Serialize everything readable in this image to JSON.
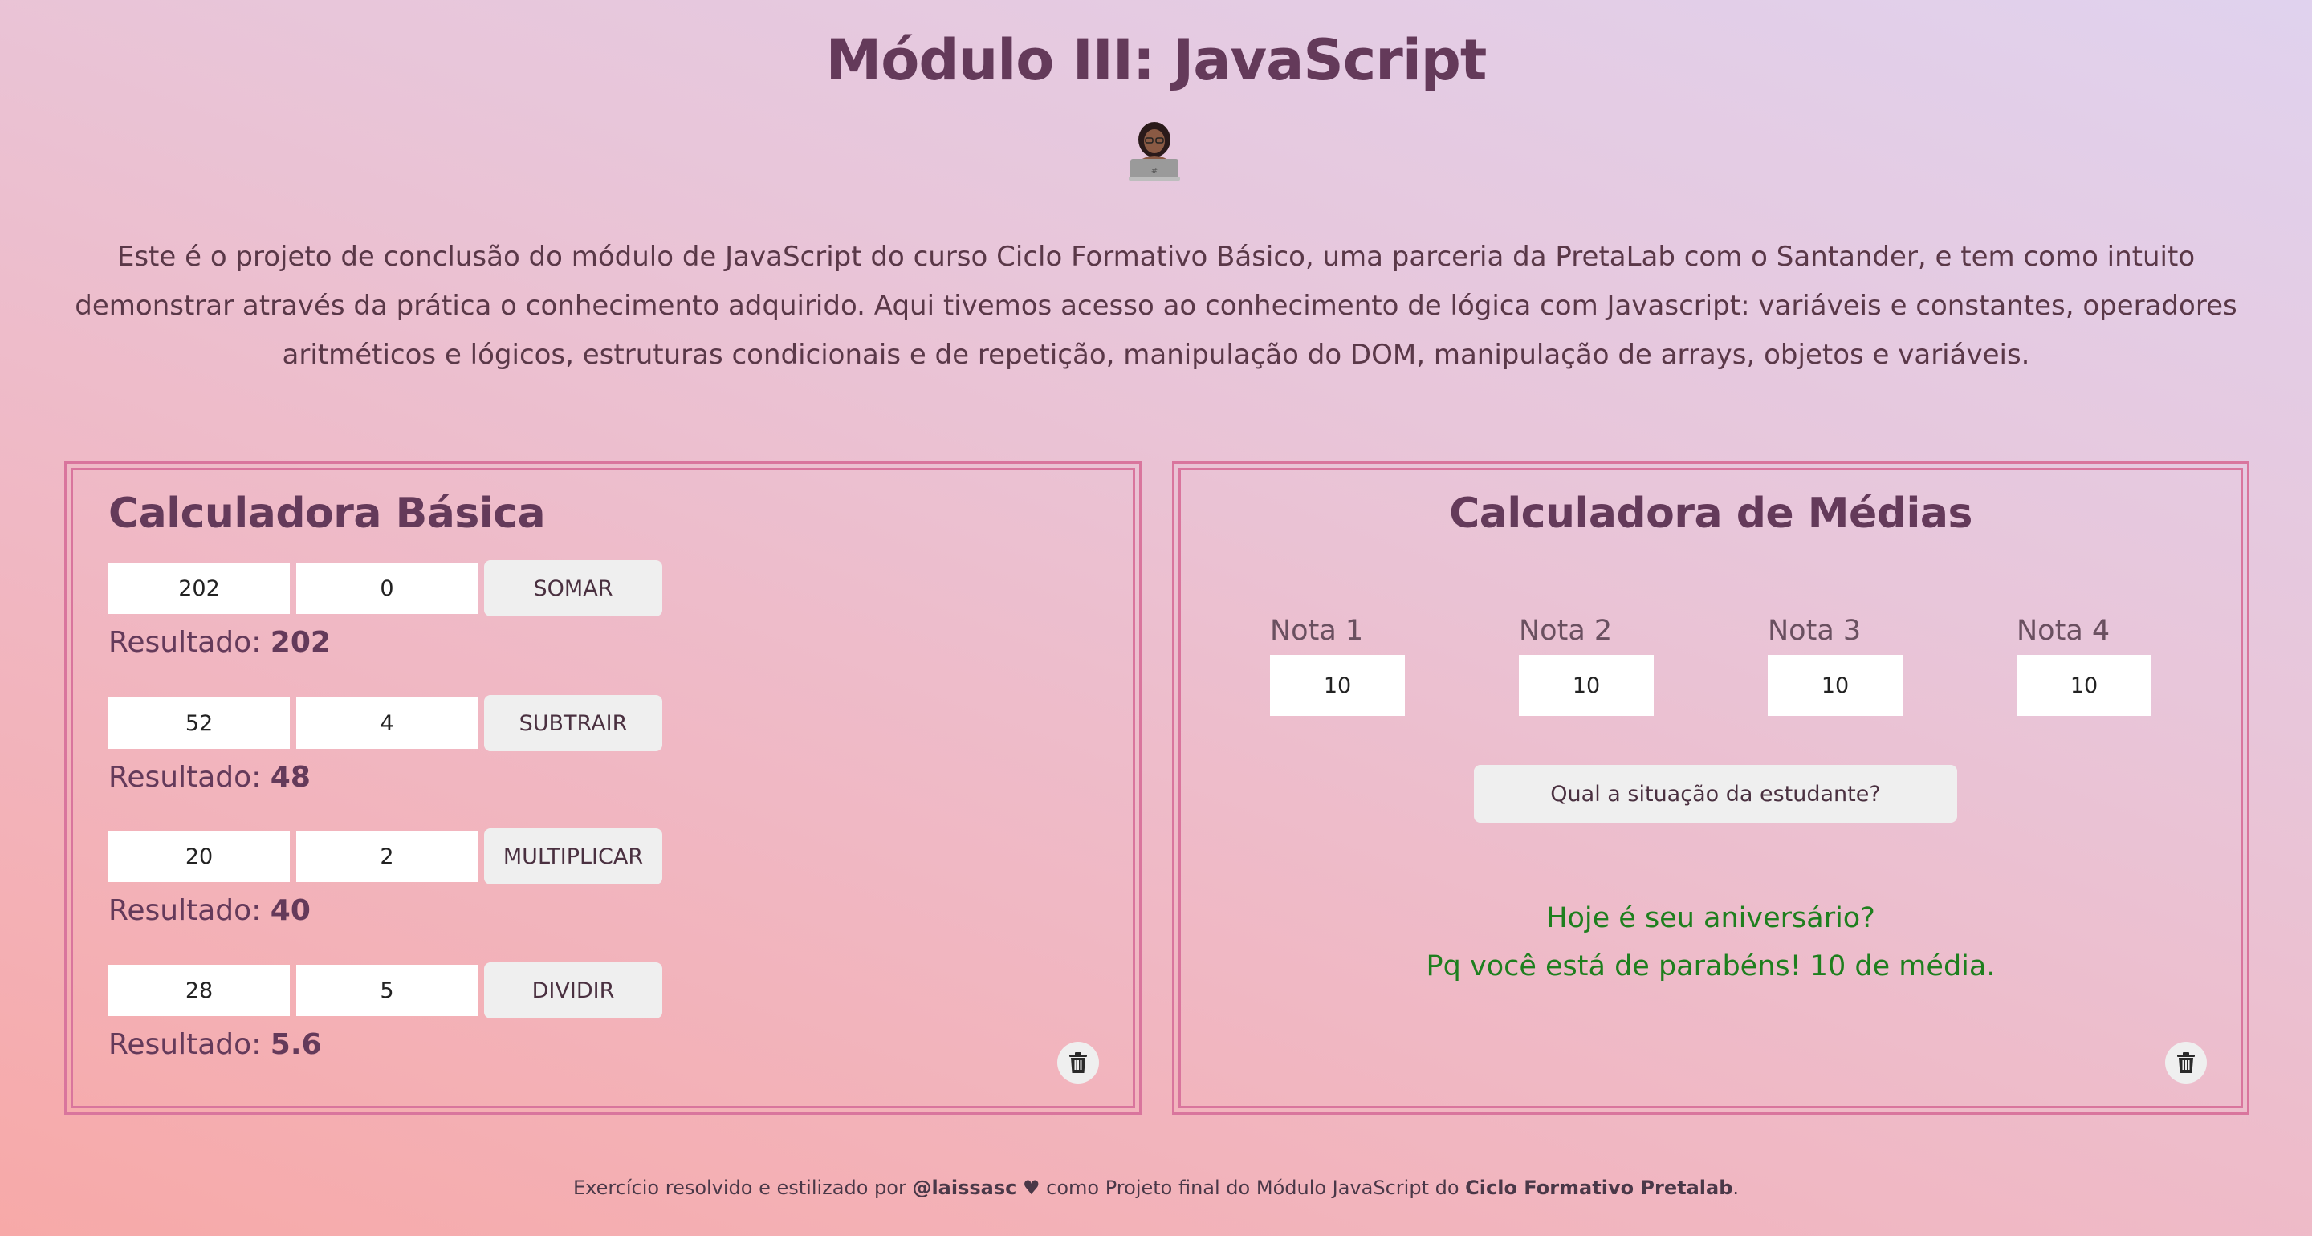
{
  "header": {
    "title": "Módulo III: JavaScript",
    "emoji_icon": "woman-technologist-icon",
    "intro": "Este é o projeto de conclusão do módulo de JavaScript do curso Ciclo Formativo Básico, uma parceria da PretaLab com o Santander, e tem como intuito demonstrar através da prática o conhecimento adquirido. Aqui tivemos acesso ao conhecimento de lógica com Javascript: variáveis e constantes, operadores aritméticos e lógicos, estruturas condicionais e de repetição, manipulação do DOM, manipulação de arrays, objetos e variáveis."
  },
  "basic_calc": {
    "title": "Calculadora Básica",
    "result_label": "Resultado:",
    "rows": [
      {
        "a": "202",
        "b": "0",
        "op": "SOMAR",
        "result": "202"
      },
      {
        "a": "52",
        "b": "4",
        "op": "SUBTRAIR",
        "result": "48"
      },
      {
        "a": "20",
        "b": "2",
        "op": "MULTIPLICAR",
        "result": "40"
      },
      {
        "a": "28",
        "b": "5",
        "op": "DIVIDIR",
        "result": "5.6"
      }
    ],
    "clear_icon": "trash-icon"
  },
  "avg_calc": {
    "title": "Calculadora de Médias",
    "grades": [
      {
        "label": "Nota 1",
        "value": "10"
      },
      {
        "label": "Nota 2",
        "value": "10"
      },
      {
        "label": "Nota 3",
        "value": "10"
      },
      {
        "label": "Nota 4",
        "value": "10"
      }
    ],
    "button": "Qual a situação da estudante?",
    "message_line1": "Hoje é seu aniversário?",
    "message_line2": "Pq você está de parabéns! 10 de média.",
    "message_color": "#1e7f1e",
    "clear_icon": "trash-icon"
  },
  "footer": {
    "text1": "Exercício resolvido e estilizado por ",
    "author": "@laissasc",
    "heart": "♥",
    "text2": " como Projeto final do Módulo JavaScript do ",
    "course": "Ciclo Formativo Pretalab",
    "end": "."
  },
  "colors": {
    "accent": "#643a5a",
    "border": "#d9759d",
    "button_bg": "#efefef"
  }
}
